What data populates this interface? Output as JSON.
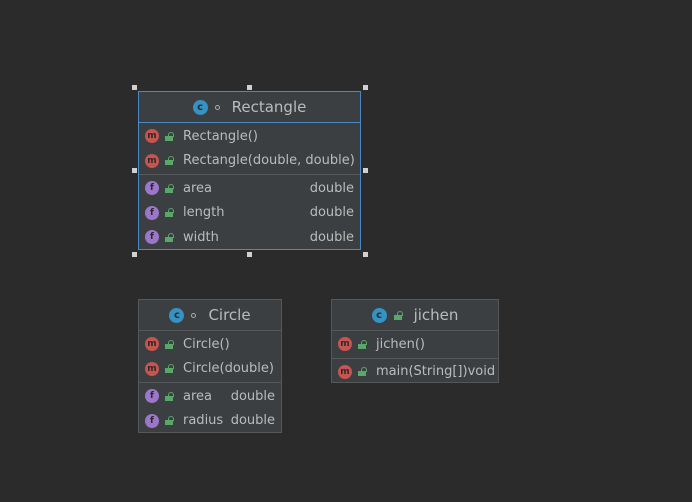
{
  "diagram": {
    "classes": [
      {
        "name": "Rectangle",
        "icon": "class-icon",
        "constructors": [
          {
            "kind": "m",
            "name": "Rectangle()",
            "type": ""
          },
          {
            "kind": "m",
            "name": "Rectangle(double, double)",
            "type": ""
          }
        ],
        "fields": [
          {
            "kind": "f",
            "name": "area",
            "type": "double"
          },
          {
            "kind": "f",
            "name": "length",
            "type": "double"
          },
          {
            "kind": "f",
            "name": "width",
            "type": "double"
          }
        ]
      },
      {
        "name": "Circle",
        "icon": "class-icon",
        "constructors": [
          {
            "kind": "m",
            "name": "Circle()",
            "type": ""
          },
          {
            "kind": "m",
            "name": "Circle(double)",
            "type": ""
          }
        ],
        "fields": [
          {
            "kind": "f",
            "name": "area",
            "type": "double"
          },
          {
            "kind": "f",
            "name": "radius",
            "type": "double"
          }
        ]
      },
      {
        "name": "jichen",
        "icon": "class-icon",
        "constructors": [
          {
            "kind": "m",
            "name": "jichen()",
            "type": ""
          }
        ],
        "fields": [
          {
            "kind": "m",
            "name": "main(String[])",
            "type": "void"
          }
        ]
      }
    ],
    "badge_letters": {
      "m": "m",
      "f": "f"
    },
    "colors": {
      "background": "#2b2b2b",
      "node": "#3c3f41",
      "selection": "#4a88c7",
      "method_badge": "#c75450",
      "field_badge": "#9b76c9",
      "class_icon": "#3592c4",
      "lock": "#59a869"
    }
  }
}
